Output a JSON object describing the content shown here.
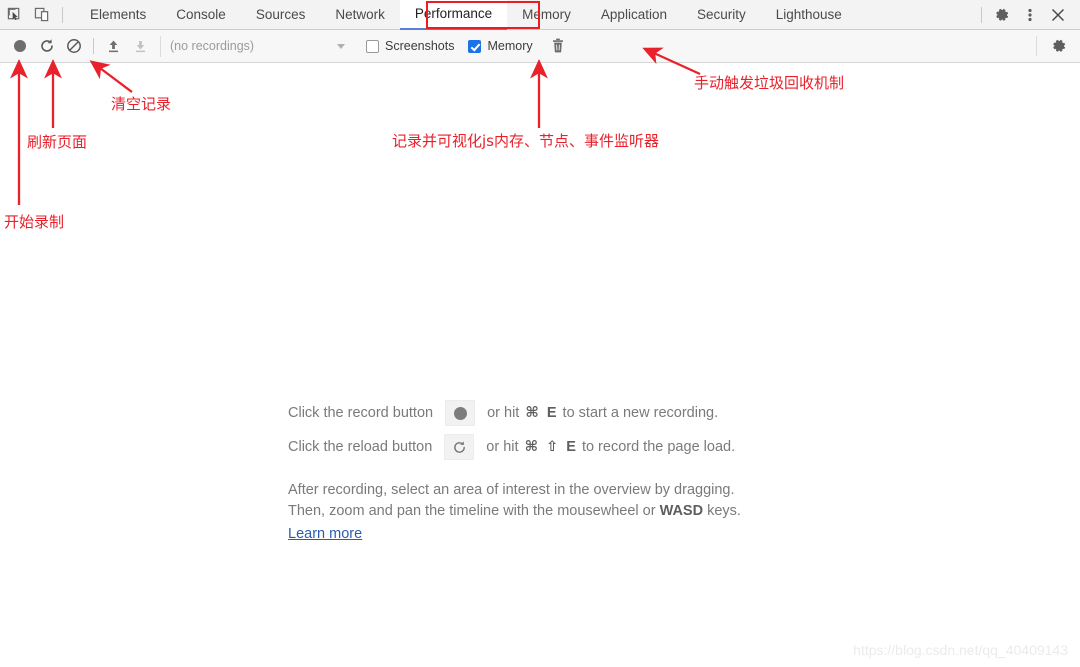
{
  "window": {
    "title": "Chrome DevTools - Performance panel"
  },
  "tabbar": {
    "inspect_icon": "inspect-cursor-icon",
    "device_icon": "device-toolbar-icon",
    "tabs": [
      {
        "label": "Elements",
        "active": false
      },
      {
        "label": "Console",
        "active": false
      },
      {
        "label": "Sources",
        "active": false
      },
      {
        "label": "Network",
        "active": false
      },
      {
        "label": "Performance",
        "active": true
      },
      {
        "label": "Memory",
        "active": false
      },
      {
        "label": "Application",
        "active": false
      },
      {
        "label": "Security",
        "active": false
      },
      {
        "label": "Lighthouse",
        "active": false
      }
    ],
    "settings_icon": "gear-icon",
    "more_icon": "vertical-dots-icon",
    "close_icon": "close-icon",
    "active_underline_color": "#5b7fd4"
  },
  "toolbar": {
    "record_icon": "record-circle-icon",
    "reload_icon": "reload-arrow-icon",
    "clear_icon": "clear-no-entry-icon",
    "load_icon": "upload-arrow-icon",
    "save_icon": "download-arrow-icon",
    "recordings_select": {
      "value": "(no recordings)",
      "caret_icon": "chevron-down-icon"
    },
    "screenshots": {
      "label": "Screenshots",
      "checked": false
    },
    "memory": {
      "label": "Memory",
      "checked": true,
      "checkbox_color": "#1a73e8"
    },
    "trash_icon": "trash-can-icon",
    "settings_icon": "gear-icon"
  },
  "main": {
    "line1": {
      "prefix": "Click the record button",
      "button_icon": "record-circle-icon",
      "mid": "or hit",
      "key1": "⌘",
      "key2": "E",
      "suffix": "to start a new recording."
    },
    "line2": {
      "prefix": "Click the reload button",
      "button_icon": "reload-arrow-icon",
      "mid": "or hit",
      "key1": "⌘",
      "key2": "⇧",
      "key3": "E",
      "suffix": "to record the page load."
    },
    "paragraph_line1": "After recording, select an area of interest in the overview by dragging.",
    "paragraph_line2_a": "Then, zoom and pan the timeline with the mousewheel or",
    "paragraph_line2_b": "WASD",
    "paragraph_line2_c": "keys.",
    "learn_more": "Learn more"
  },
  "annotations": {
    "color": "#e8212b",
    "highlight_box_target": "Performance",
    "items": [
      {
        "id": "start-recording",
        "text": "开始录制"
      },
      {
        "id": "refresh-page",
        "text": "刷新页面"
      },
      {
        "id": "clear-records",
        "text": "清空记录"
      },
      {
        "id": "memory-record",
        "text": "记录并可视化js内存、节点、事件监听器"
      },
      {
        "id": "trigger-gc",
        "text": "手动触发垃圾回收机制"
      }
    ]
  },
  "watermark": {
    "text": "https://blog.csdn.net/qq_40409143"
  }
}
